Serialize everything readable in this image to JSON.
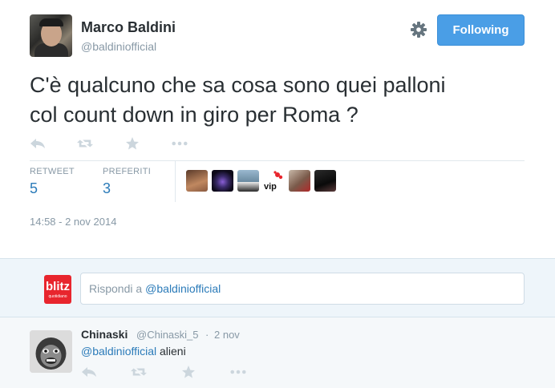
{
  "author": {
    "name": "Marco Baldini",
    "handle": "@baldiniofficial"
  },
  "follow_button": {
    "label": "Following",
    "color": "#4a9ee6"
  },
  "tweet": {
    "line1": "C'è qualcuno che sa cosa sono quei palloni",
    "line2": "col count down in giro per Roma ?",
    "timestamp": "14:58 - 2 nov 2014"
  },
  "actions": [
    "reply-icon",
    "retweet-icon",
    "favorite-icon",
    "more-icon"
  ],
  "stats": {
    "retweets_label": "RETWEET",
    "retweets_value": "5",
    "favorites_label": "PREFERITI",
    "favorites_value": "3"
  },
  "favoriters": [
    {
      "name": "avatar-1",
      "color": "#a0522d"
    },
    {
      "name": "avatar-2",
      "color": "#2a1f4a"
    },
    {
      "name": "avatar-3",
      "color": "#6b8fa8"
    },
    {
      "name": "avatar-vip",
      "color": "#ffffff",
      "text": "vip"
    },
    {
      "name": "avatar-5",
      "color": "#8a6a5a"
    },
    {
      "name": "avatar-6",
      "color": "#1a1a1a"
    }
  ],
  "reply_box": {
    "prefix": "Rispondi a",
    "mention": "@baldiniofficial",
    "logo_text": "blitz",
    "logo_sub": "quotidiano"
  },
  "reply": {
    "name": "Chinaski",
    "handle": "@Chinaski_5",
    "separator": "·",
    "time": "2 nov",
    "mention": "@baldiniofficial",
    "text": " alieni"
  },
  "colors": {
    "link": "#2b7bb9",
    "muted": "#8899a6",
    "accent": "#4a9ee6"
  }
}
